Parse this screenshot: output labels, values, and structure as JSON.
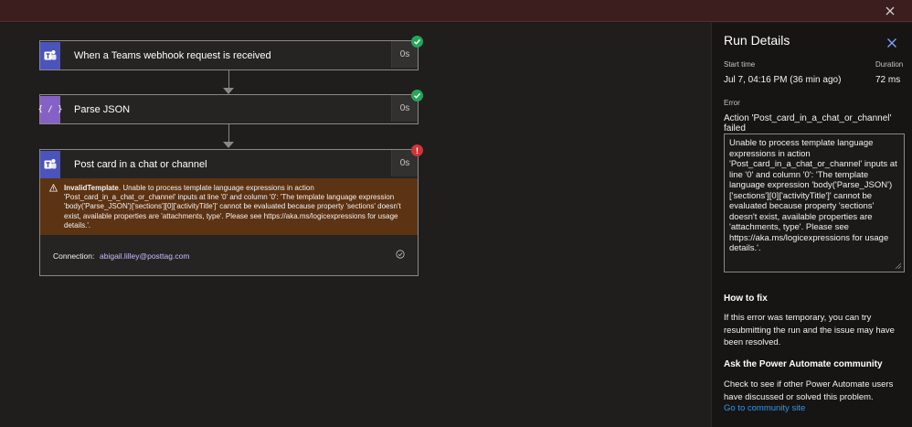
{
  "flow": {
    "steps": [
      {
        "title": "When a Teams webhook request is received",
        "duration": "0s",
        "status": "succeeded",
        "icon": "teams-icon"
      },
      {
        "title": "Parse JSON",
        "duration": "0s",
        "status": "succeeded",
        "icon": "parse-json-icon"
      },
      {
        "title": "Post card in a chat or channel",
        "duration": "0s",
        "status": "failed",
        "icon": "teams-icon",
        "error_code": "InvalidTemplate",
        "error_message": ". Unable to process template language expressions in action 'Post_card_in_a_chat_or_channel' inputs at line '0' and column '0': 'The template language expression 'body('Parse_JSON')['sections'][0]['activityTitle']' cannot be evaluated because property 'sections' doesn't exist, available properties are 'attachments, type'. Please see https://aka.ms/logicexpressions for usage details.'.",
        "connection_label": "Connection:",
        "connection_value": "abigail.lilley@posttag.com"
      }
    ]
  },
  "panel": {
    "title": "Run Details",
    "start_time_label": "Start time",
    "start_time_value": "Jul 7, 04:16 PM (36 min ago)",
    "duration_label": "Duration",
    "duration_value": "72 ms",
    "error_label": "Error",
    "error_summary": "Action 'Post_card_in_a_chat_or_channel' failed",
    "error_details": "Unable to process template language expressions in action 'Post_card_in_a_chat_or_channel' inputs at line '0' and column '0': 'The template language expression 'body('Parse_JSON')['sections'][0]['activityTitle']' cannot be evaluated because property 'sections' doesn't exist, available properties are 'attachments, type'. Please see https://aka.ms/logicexpressions for usage details.'.",
    "how_to_fix_heading": "How to fix",
    "how_to_fix_text": "If this error was temporary, you can try resubmitting the run and the issue may have been resolved.",
    "community_heading": "Ask the Power Automate community",
    "community_text": "Check to see if other Power Automate users have discussed or solved this problem.",
    "community_link": "Go to community site"
  },
  "colors": {
    "teams": "#4b53bc",
    "parse_json": "#8661c5",
    "success": "#27a55a",
    "failure": "#d13438",
    "error_banner": "#5c3313",
    "link": "#2899f5"
  }
}
